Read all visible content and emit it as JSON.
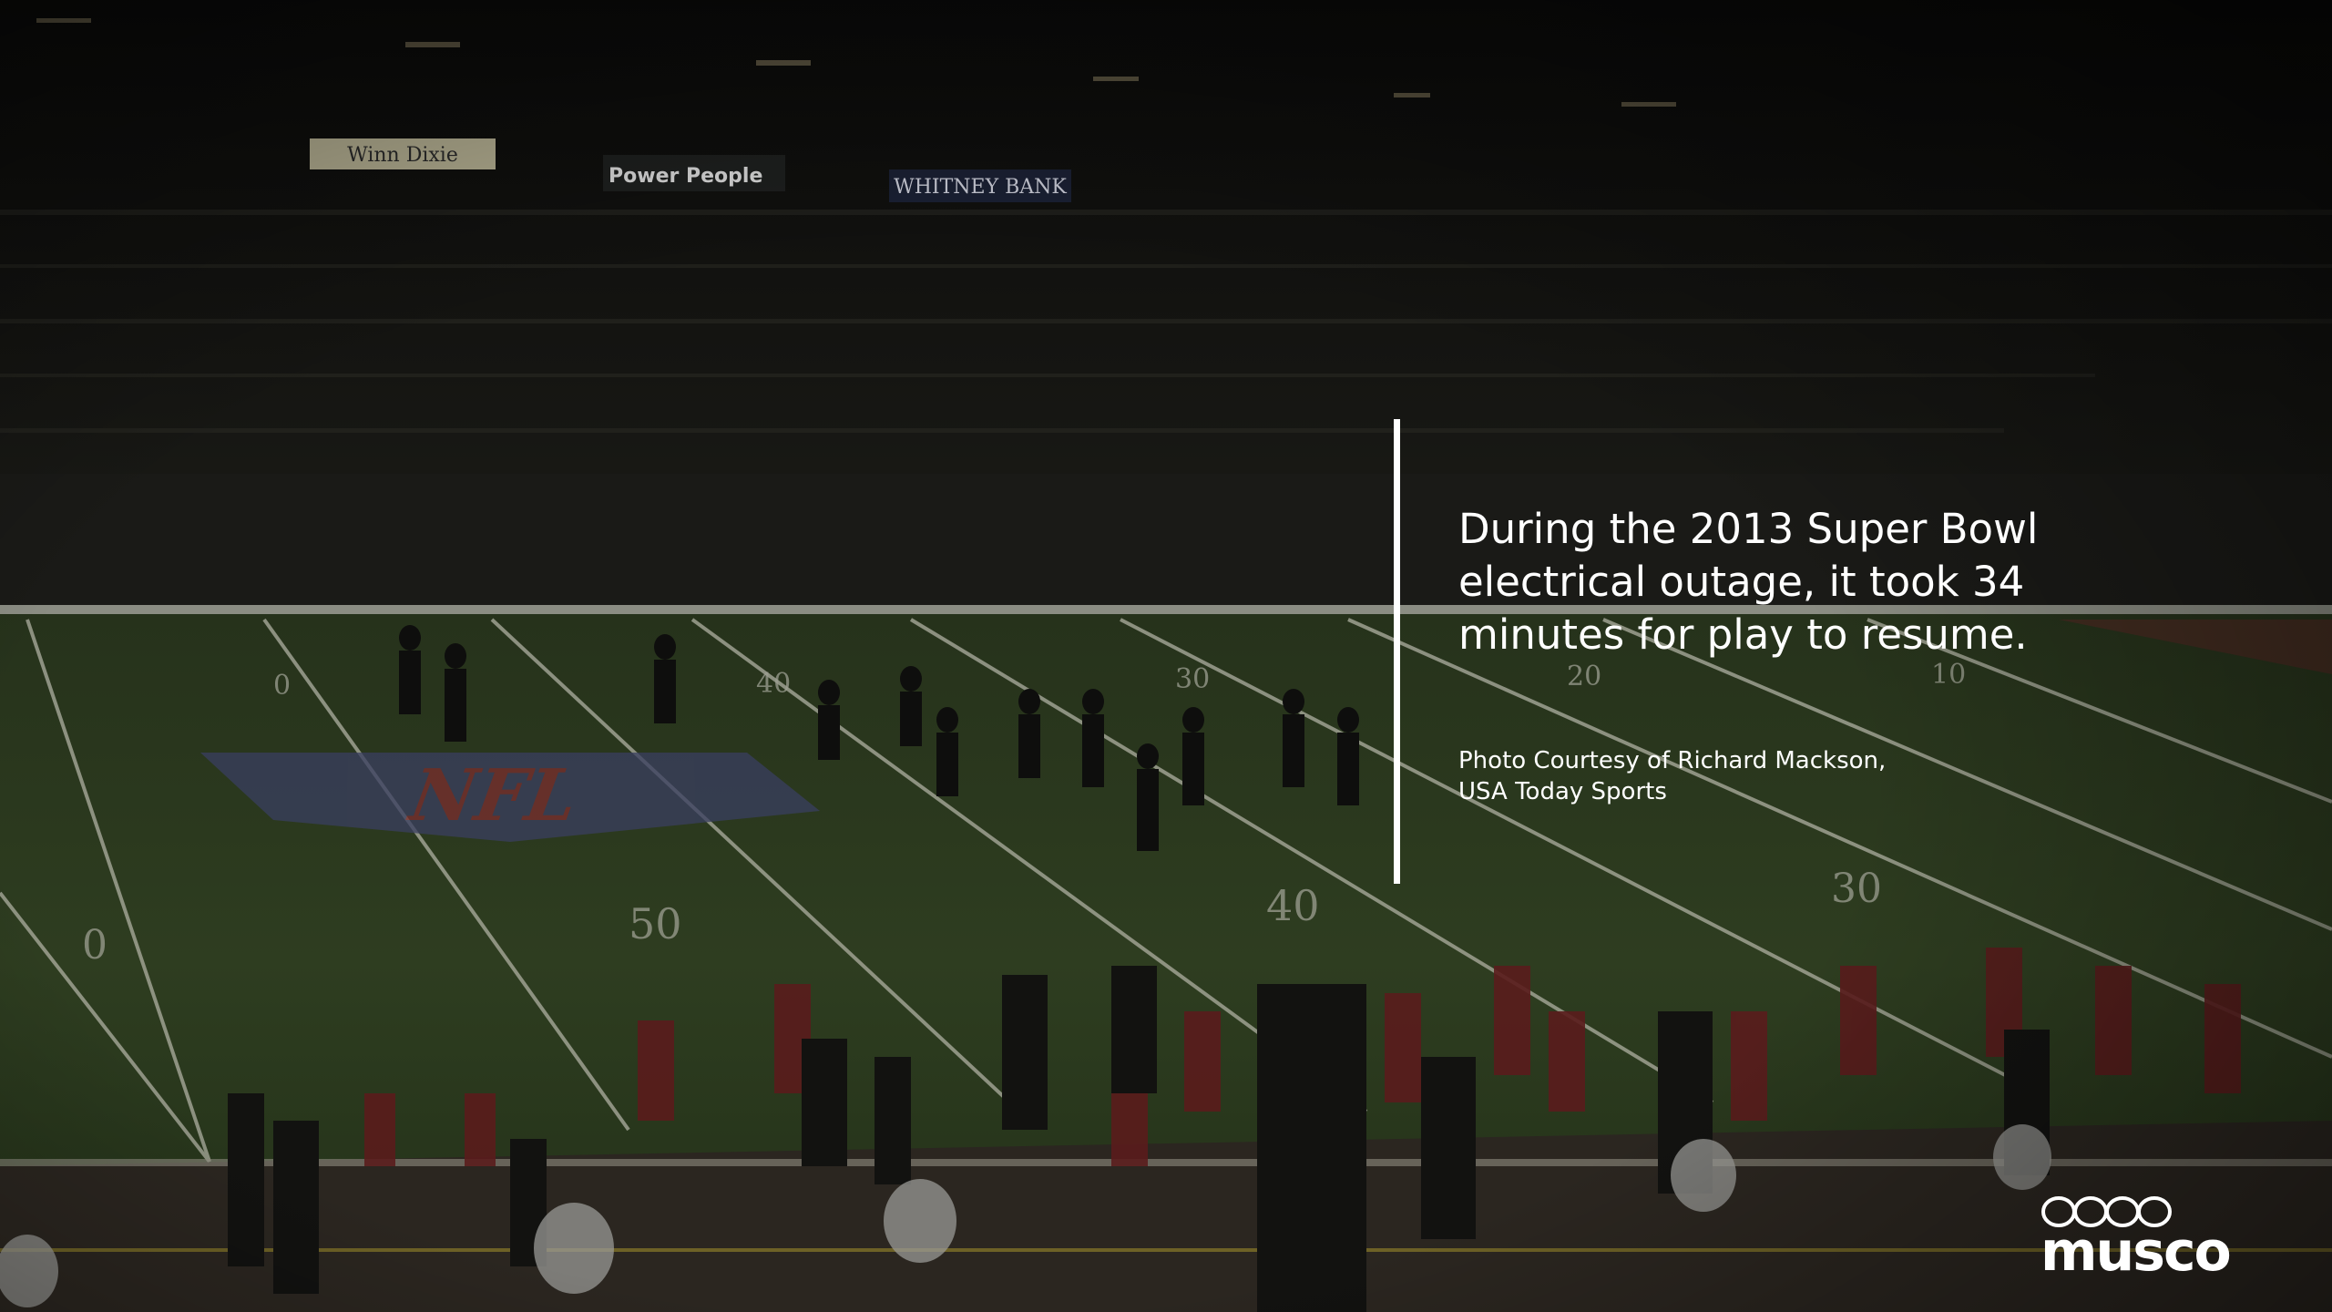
{
  "slide": {
    "headline": "During the 2013 Super Bowl electrical outage, it took 34 minutes for play to resume.",
    "credit_line1": "Photo Courtesy of Richard Mackson,",
    "credit_line2": "USA Today Sports"
  },
  "photo": {
    "signs": [
      "Winn-Dixie",
      "Power·People",
      "Whitney Bank"
    ],
    "field_logo": "NFL",
    "yard_numbers": [
      "50",
      "40",
      "30",
      "20",
      "10"
    ]
  },
  "brand": {
    "name": "MUSCO",
    "text_color": "#ffffff",
    "field_color": "#2c3a1e",
    "crowd_color": "#141411"
  }
}
